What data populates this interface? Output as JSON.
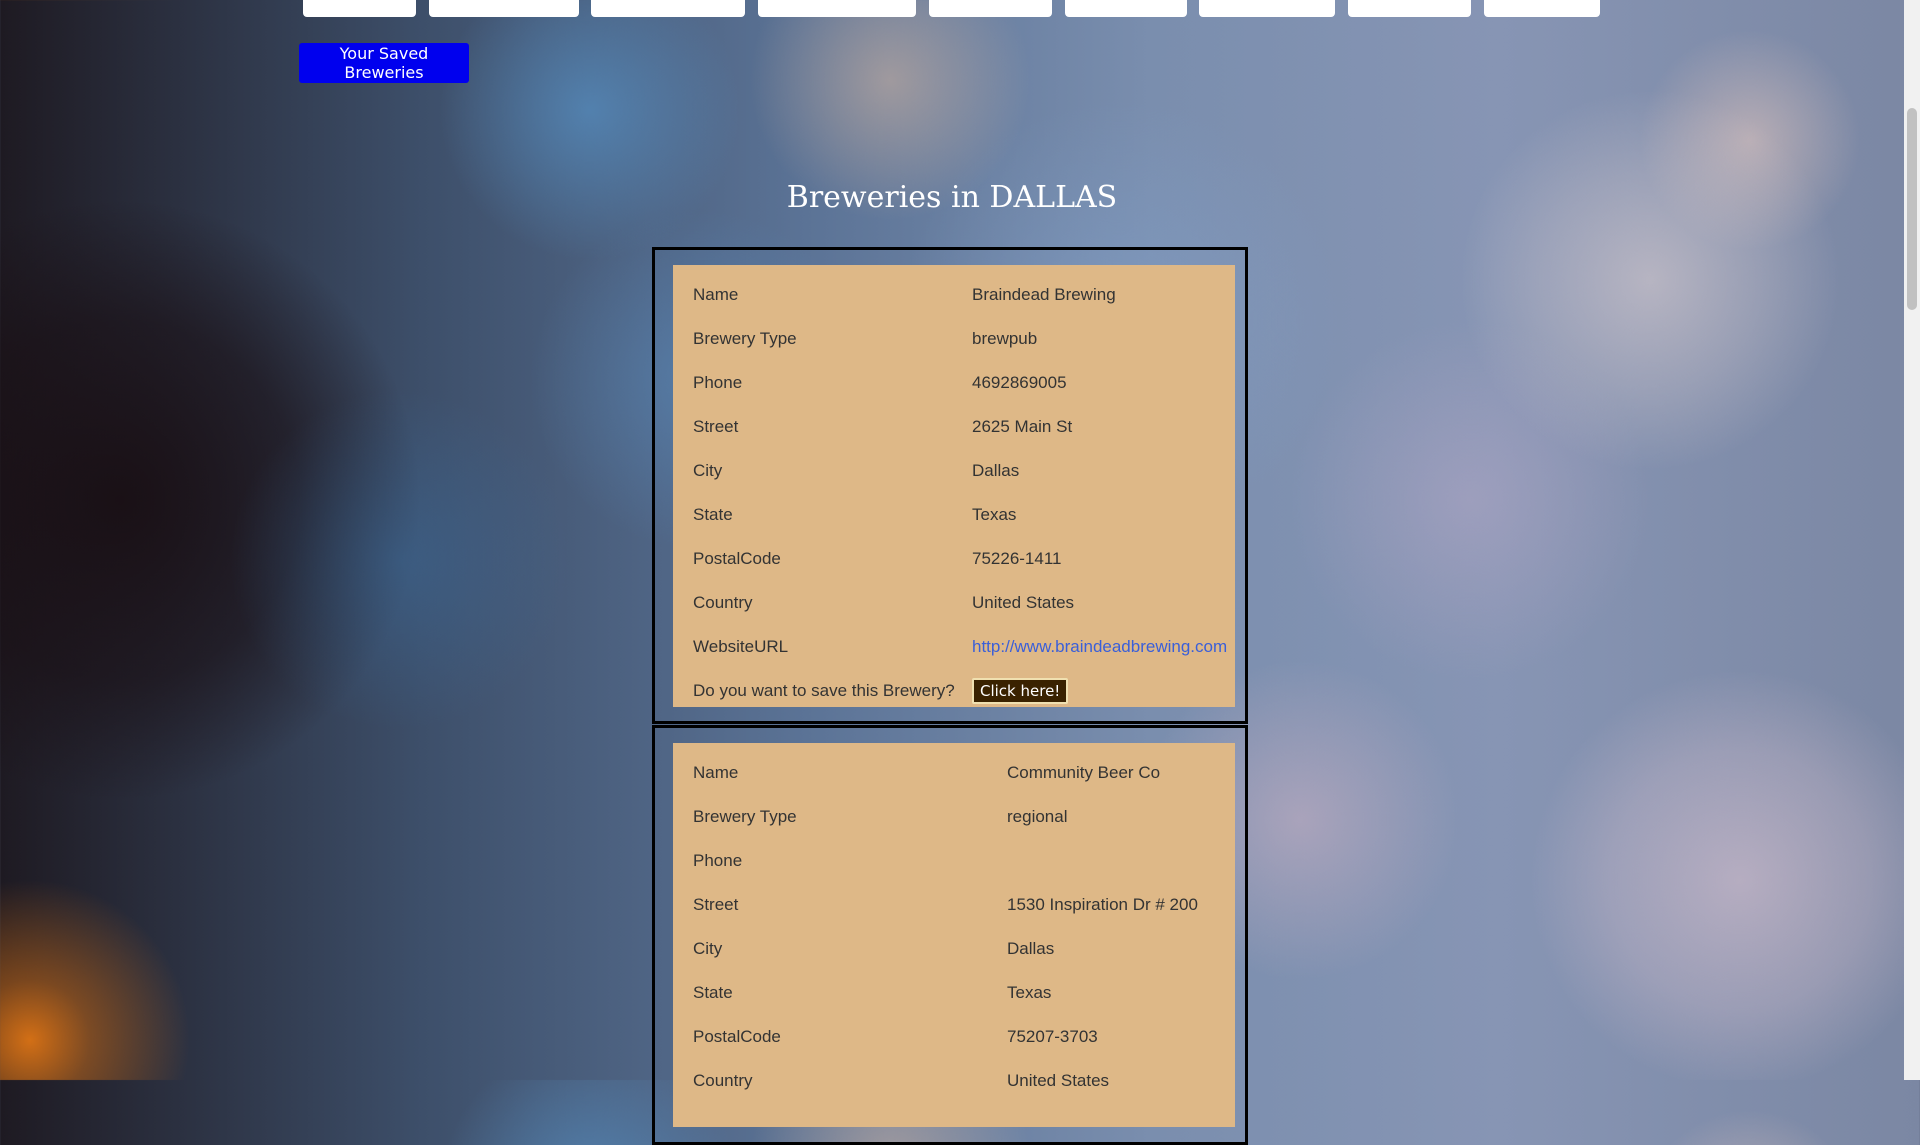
{
  "header": {
    "saved_button_label": "Your Saved Breweries"
  },
  "main": {
    "title": "Breweries in DALLAS"
  },
  "breweries": [
    {
      "labels": {
        "name": "Name",
        "type": "Brewery Type",
        "phone": "Phone",
        "street": "Street",
        "city": "City",
        "state": "State",
        "postal": "PostalCode",
        "country": "Country",
        "website": "WebsiteURL",
        "save_prompt": "Do you want to save this Brewery?"
      },
      "name": "Braindead Brewing",
      "type": "brewpub",
      "phone": "4692869005",
      "street": "2625 Main St",
      "city": "Dallas",
      "state": "Texas",
      "postal": "75226-1411",
      "country": "United States",
      "website": "http://www.braindeadbrewing.com",
      "save_button_label": "Click here!"
    },
    {
      "labels": {
        "name": "Name",
        "type": "Brewery Type",
        "phone": "Phone",
        "street": "Street",
        "city": "City",
        "state": "State",
        "postal": "PostalCode",
        "country": "Country"
      },
      "name": "Community Beer Co",
      "type": "regional",
      "phone": "",
      "street": "1530 Inspiration Dr # 200",
      "city": "Dallas",
      "state": "Texas",
      "postal": "75207-3703",
      "country": "United States"
    }
  ]
}
